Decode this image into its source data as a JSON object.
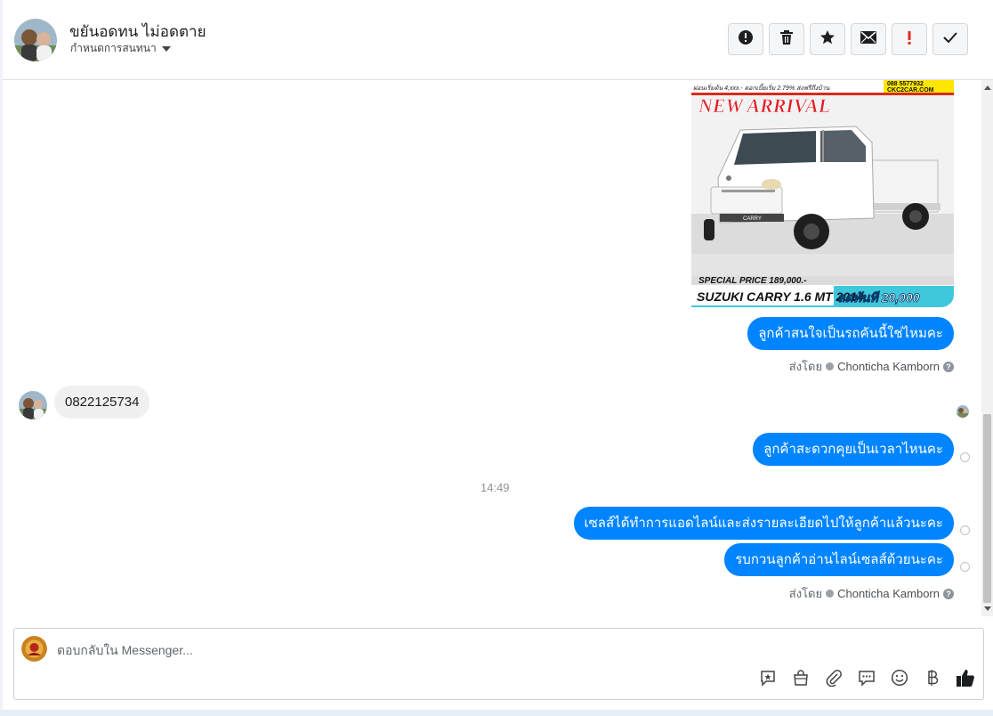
{
  "header": {
    "contact_name": "ขยันอดทน ไม่อดตาย",
    "assign_label": "กำหนดการสนทนา",
    "actions": [
      {
        "name": "spam-button",
        "icon": "alert-circle-icon"
      },
      {
        "name": "delete-button",
        "icon": "trash-icon"
      },
      {
        "name": "star-button",
        "icon": "star-icon"
      },
      {
        "name": "mark-unread-button",
        "icon": "envelope-icon"
      },
      {
        "name": "follow-up-button",
        "icon": "exclamation-icon"
      },
      {
        "name": "done-button",
        "icon": "check-icon"
      }
    ]
  },
  "ad_image": {
    "top_line": "ผ่อนเริ่มต้น 4,xxx.-    ดอกเบี้ยเริ่ม 2.79%    ส่งฟรีถึงบ้าน",
    "phone": "088 5577932",
    "site": "CKC2CAR.COM",
    "headline": "NEW ARRIVAL",
    "special_price": "SPECIAL PRICE 189,000.-",
    "model": "SUZUKI CARRY 1.6 MT 2014",
    "discount": "ลดทันที 20,000",
    "plate": "CARRY"
  },
  "messages": {
    "m1": "ลูกค้าสนใจเป็นรถคันนี้ใช่ไหมคะ",
    "m2": "0822125734",
    "m3": "ลูกค้าสะดวกคุยเป็นเวลาไหนคะ",
    "time": "14:49",
    "m4": "เซลส์ได้ทำการแอดไลน์และส่งรายละเอียดไปให้ลูกค้าแล้วนะคะ",
    "m5": "รบกวนลูกค้าอ่านไลน์เซลส์ด้วยนะคะ"
  },
  "sent_by": {
    "prefix": "ส่งโดย",
    "agent": "Chonticha Kamborn"
  },
  "composer": {
    "placeholder": "ตอบกลับใน Messenger...",
    "tools": [
      "saved-reply-icon",
      "shop-icon",
      "attachment-icon",
      "chat-icon",
      "emoji-icon",
      "baht-icon",
      "like-icon"
    ]
  },
  "colors": {
    "bubble_out": "#0084ff",
    "bubble_in": "#f1f0f0",
    "ad_red": "#e21f26",
    "ad_yellow": "#ffe600",
    "ad_cyan": "#3fc7dc"
  }
}
